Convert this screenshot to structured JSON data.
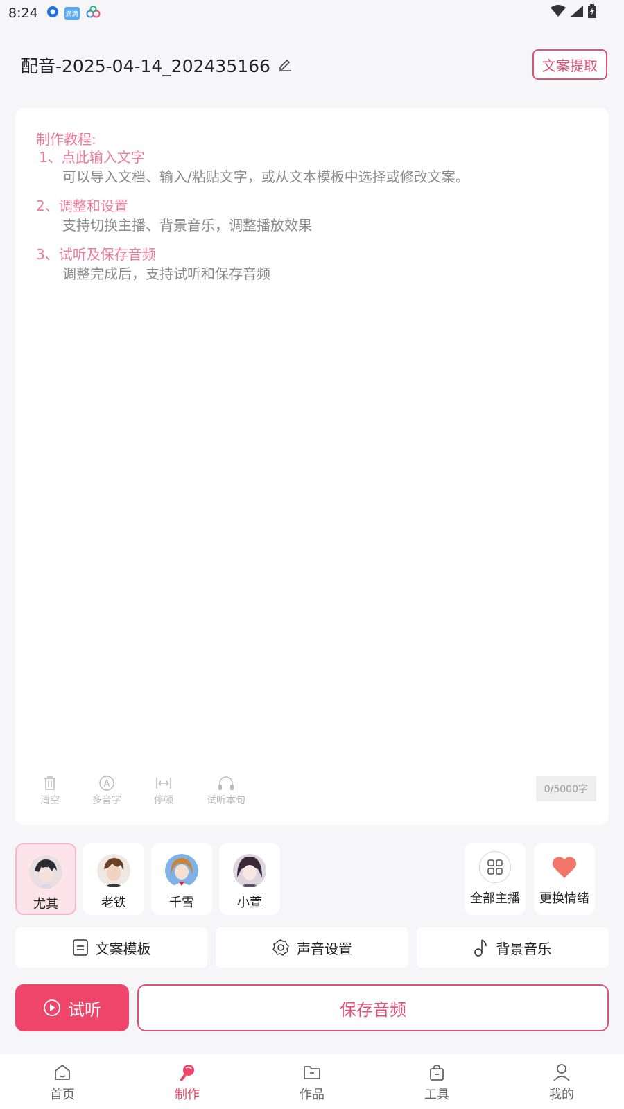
{
  "status_bar": {
    "time": "8:24",
    "badge_text": "滴滴"
  },
  "header": {
    "title": "配音-2025-04-14_202435166",
    "extract_button": "文案提取"
  },
  "tutorial": {
    "title": "制作教程:",
    "steps": [
      {
        "heading": "1、点此输入文字",
        "desc": "可以导入文档、输入/粘贴文字，或从文本模板中选择或修改文案。"
      },
      {
        "heading": "2、调整和设置",
        "desc": "支持切换主播、背景音乐，调整播放效果"
      },
      {
        "heading": "3、试听及保存音频",
        "desc": "调整完成后，支持试听和保存音频"
      }
    ]
  },
  "editor_tools": [
    {
      "label": "清空",
      "icon": "trash-icon"
    },
    {
      "label": "多音字",
      "icon": "polyphone-icon"
    },
    {
      "label": "停顿",
      "icon": "pause-width-icon"
    },
    {
      "label": "试听本句",
      "icon": "headphones-icon"
    }
  ],
  "char_count": "0/5000字",
  "voices": [
    {
      "name": "尤其",
      "selected": true
    },
    {
      "name": "老铁",
      "selected": false
    },
    {
      "name": "千雪",
      "selected": false
    },
    {
      "name": "小萱",
      "selected": false
    }
  ],
  "voice_actions": [
    {
      "label": "全部主播",
      "icon": "grid-icon"
    },
    {
      "label": "更换情绪",
      "icon": "heart-icon"
    }
  ],
  "features": [
    {
      "label": "文案模板",
      "icon": "document-icon"
    },
    {
      "label": "声音设置",
      "icon": "settings-icon"
    },
    {
      "label": "背景音乐",
      "icon": "music-note-icon"
    }
  ],
  "actions": {
    "listen": "试听",
    "save": "保存音频"
  },
  "nav": [
    {
      "label": "首页",
      "icon": "home-icon",
      "active": false
    },
    {
      "label": "制作",
      "icon": "microphone-icon",
      "active": true
    },
    {
      "label": "作品",
      "icon": "folder-icon",
      "active": false
    },
    {
      "label": "工具",
      "icon": "bag-icon",
      "active": false
    },
    {
      "label": "我的",
      "icon": "user-icon",
      "active": false
    }
  ],
  "colors": {
    "accent": "#f0456a",
    "tutorial": "#ef7a9a",
    "background": "#f6f6f9"
  }
}
